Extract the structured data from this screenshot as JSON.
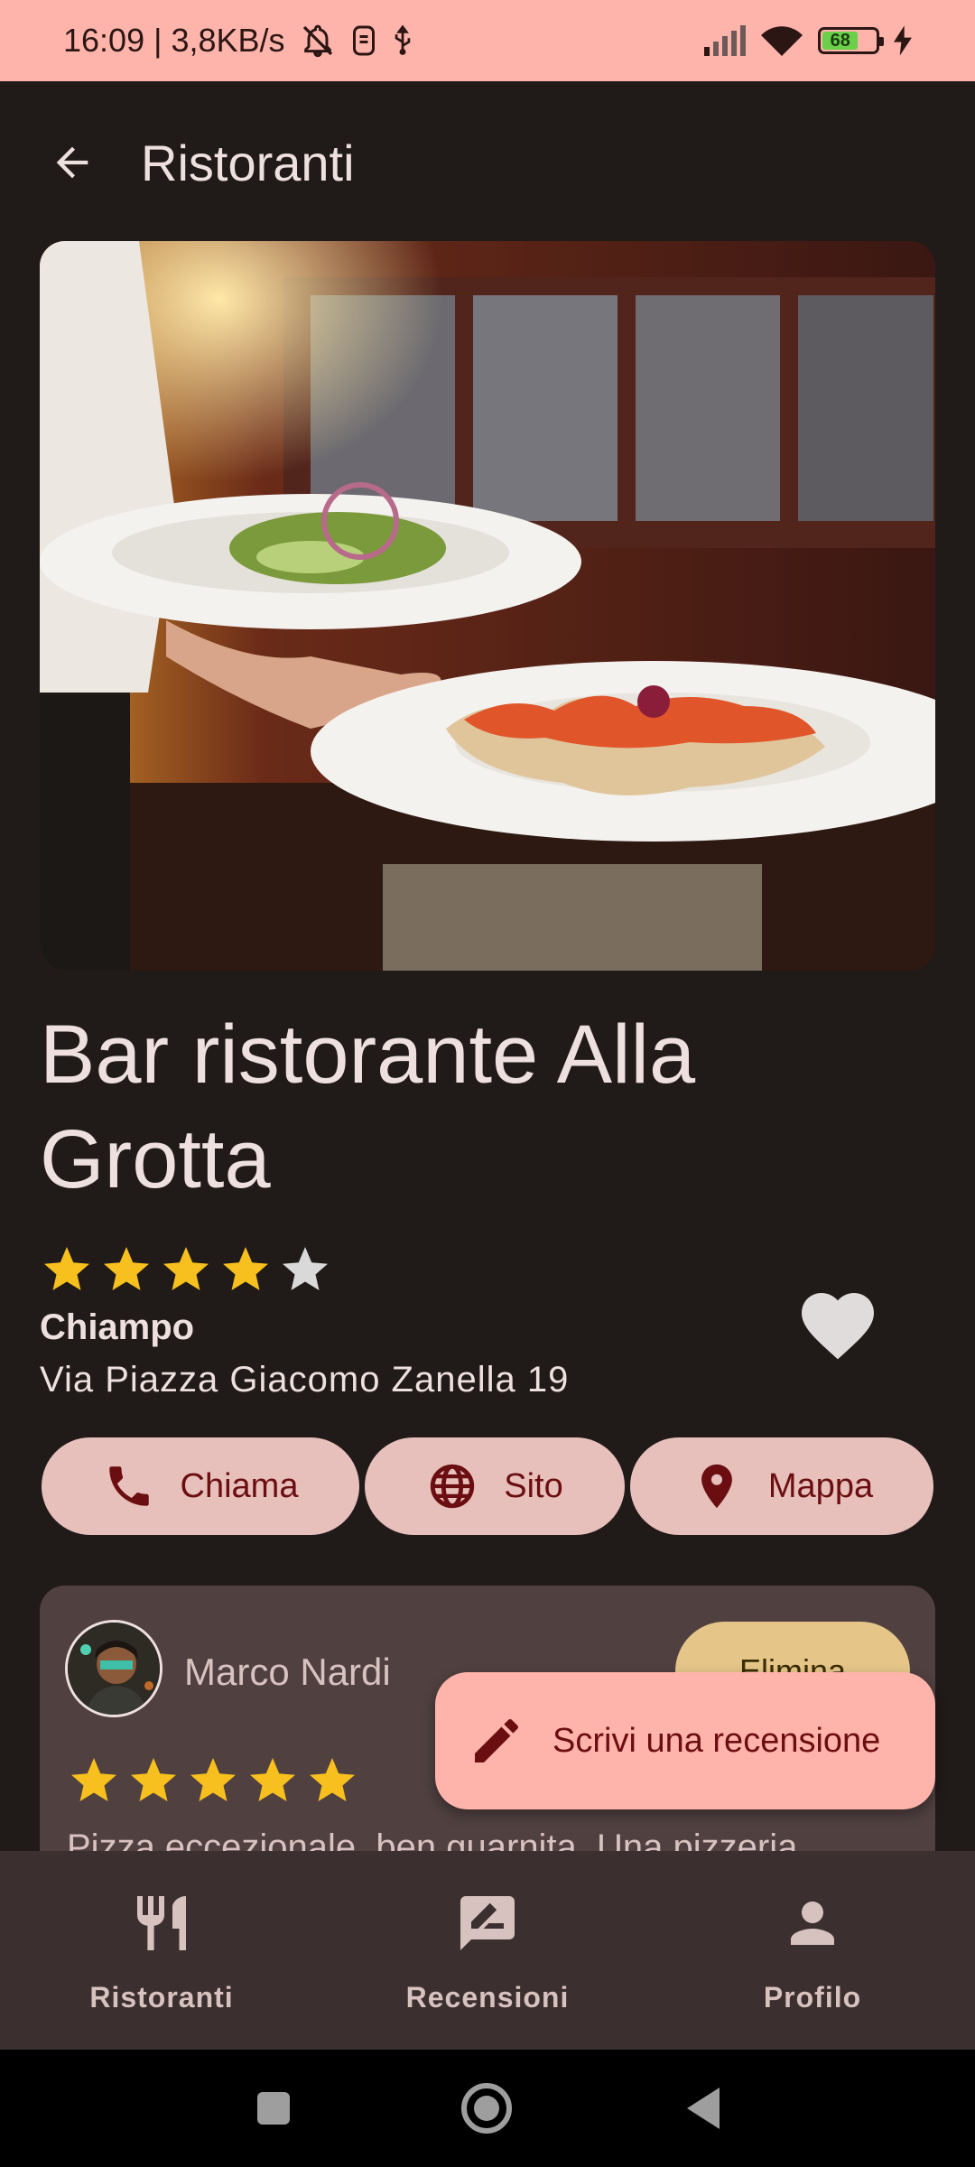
{
  "status_bar": {
    "time_info": "16:09 | 3,8KB/s",
    "battery": "68"
  },
  "appbar": {
    "title": "Ristoranti"
  },
  "restaurant": {
    "name": "Bar ristorante Alla Grotta",
    "rating": 4,
    "max_rating": 5,
    "city": "Chiampo",
    "address": "Via Piazza Giacomo Zanella 19",
    "favorite": true
  },
  "actions": {
    "call_label": "Chiama",
    "site_label": "Sito",
    "map_label": "Mappa"
  },
  "review": {
    "author": "Marco Nardi",
    "delete_label": "Elimina",
    "rating": 5,
    "text": "Pizza eccezionale, ben guarnita. Una pizzeria"
  },
  "fab": {
    "label": "Scrivi una recensione"
  },
  "bottom_nav": {
    "items": [
      {
        "label": "Ristoranti",
        "icon": "restaurant-icon"
      },
      {
        "label": "Recensioni",
        "icon": "rate-review-icon"
      },
      {
        "label": "Profilo",
        "icon": "person-icon"
      }
    ]
  },
  "colors": {
    "background": "#201a19",
    "accent": "#ffb4ab",
    "button": "#e8c0bb",
    "star": "#f7c01e",
    "star_empty": "#d9d9d9"
  }
}
